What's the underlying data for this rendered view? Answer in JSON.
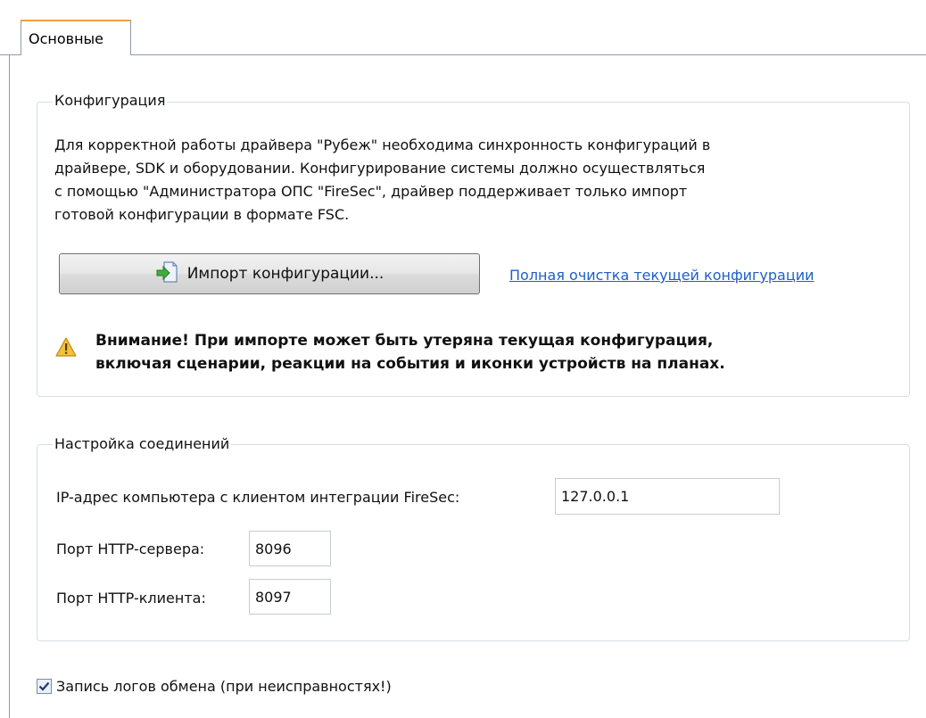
{
  "tabs": [
    {
      "label": "Основные",
      "active": true
    }
  ],
  "configuration": {
    "title": "Конфигурация",
    "description_lines": [
      "Для корректной работы драйвера \"Рубеж\" необходима синхронность конфигураций в",
      "драйвере, SDK и оборудовании. Конфигурирование системы должно осуществляться",
      "с помощью \"Администратора ОПС \"FireSec\", драйвер поддерживает только импорт",
      "готовой конфигурации в формате FSC."
    ],
    "import_button_label": "Импорт конфигурации...",
    "import_button_icon": "import-file-icon",
    "clear_link_label": "Полная очистка текущей конфигурации",
    "warning_icon": "warning-icon",
    "warning_lines": [
      "Внимание! При импорте может быть утеряна текущая конфигурация,",
      "включая сценарии, реакции на события и иконки устройств на планах."
    ]
  },
  "connections": {
    "title": "Настройка соединений",
    "ip_label": "IP-адрес компьютера с клиентом интеграции FireSec:",
    "ip_value": "127.0.0.1",
    "http_server_label": "Порт HTTP-сервера:",
    "http_server_value": "8096",
    "http_client_label": "Порт HTTP-клиента:",
    "http_client_value": "8097"
  },
  "logging": {
    "label": "Запись логов обмена (при неисправностях!)",
    "checked": true
  },
  "colors": {
    "link": "#1f5fc7",
    "group_border": "#d5dfe5",
    "tab_accent": "#f0a040"
  }
}
